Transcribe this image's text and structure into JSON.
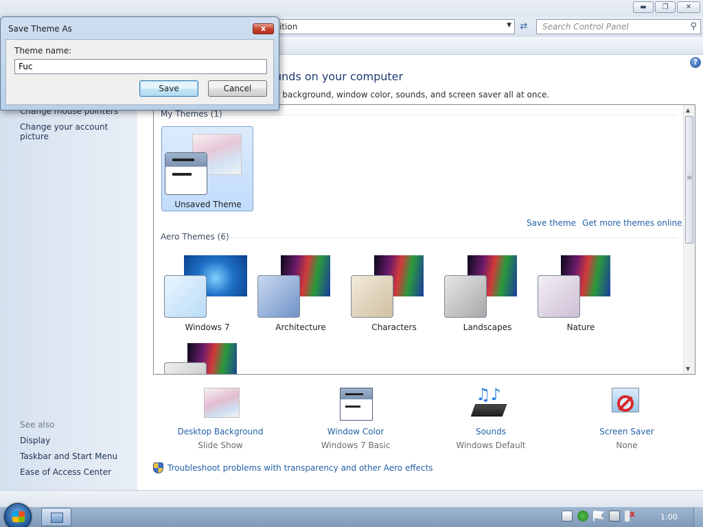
{
  "window": {
    "address_text": "ition",
    "search_placeholder": "Search Control Panel",
    "main_heading": "unds on your computer",
    "main_description": "p background, window color, sounds, and screen saver all at once."
  },
  "sidebar": {
    "partial_link": "Change mouse pointers",
    "account_picture_link": "Change your account picture",
    "see_also_heading": "See also",
    "see_also": [
      "Display",
      "Taskbar and Start Menu",
      "Ease of Access Center"
    ]
  },
  "themes": {
    "my_themes_label": "My Themes (1)",
    "unsaved_theme_label": "Unsaved Theme",
    "save_theme_link": "Save theme",
    "get_more_link": "Get more themes online",
    "aero_themes_label": "Aero Themes (6)",
    "aero": [
      "Windows 7",
      "Architecture",
      "Characters",
      "Landscapes",
      "Nature"
    ]
  },
  "settings": [
    {
      "label": "Desktop Background",
      "value": "Slide Show",
      "icon": "desktop-background-icon"
    },
    {
      "label": "Window Color",
      "value": "Windows 7 Basic",
      "icon": "window-color-icon"
    },
    {
      "label": "Sounds",
      "value": "Windows Default",
      "icon": "sounds-icon"
    },
    {
      "label": "Screen Saver",
      "value": "None",
      "icon": "screen-saver-icon"
    }
  ],
  "troubleshoot_link": "Troubleshoot problems with transparency and other Aero effects",
  "dialog": {
    "title": "Save Theme As",
    "field_label": "Theme name:",
    "field_value": "Fuc",
    "save_label": "Save",
    "cancel_label": "Cancel",
    "close_glyph": "x"
  },
  "taskbar": {
    "clock": "1:00"
  },
  "colors": {
    "link": "#2360a6",
    "heading": "#1e3b73",
    "selection": "#c1dcfc"
  }
}
